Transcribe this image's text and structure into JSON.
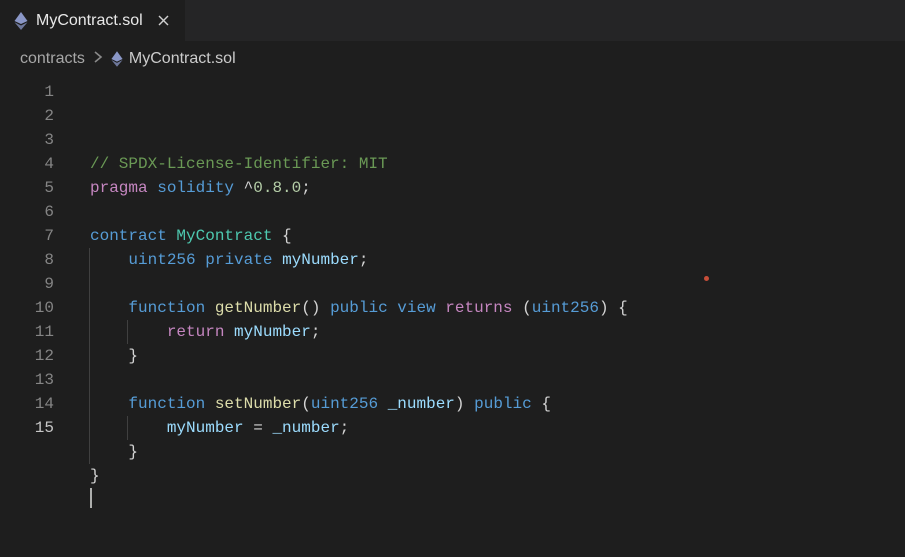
{
  "tab": {
    "filename": "MyContract.sol",
    "language_icon": "ethereum-icon",
    "close_tooltip": "Close"
  },
  "breadcrumb": {
    "segments": [
      {
        "label": "contracts",
        "icon": null
      },
      {
        "label": "MyContract.sol",
        "icon": "ethereum-icon"
      }
    ]
  },
  "editor": {
    "cursor_line": 15,
    "lines": [
      {
        "n": 1,
        "tokens": [
          {
            "t": "// SPDX-License-Identifier: MIT",
            "c": "c-comment"
          }
        ]
      },
      {
        "n": 2,
        "tokens": [
          {
            "t": "pragma",
            "c": "c-keyword"
          },
          {
            "t": " ",
            "c": ""
          },
          {
            "t": "solidity",
            "c": "c-blue"
          },
          {
            "t": " ",
            "c": ""
          },
          {
            "t": "^",
            "c": "c-punc"
          },
          {
            "t": "0.8.0",
            "c": "c-number"
          },
          {
            "t": ";",
            "c": "c-punc"
          }
        ]
      },
      {
        "n": 3,
        "tokens": []
      },
      {
        "n": 4,
        "tokens": [
          {
            "t": "contract",
            "c": "c-blue"
          },
          {
            "t": " ",
            "c": ""
          },
          {
            "t": "MyContract",
            "c": "c-type"
          },
          {
            "t": " ",
            "c": ""
          },
          {
            "t": "{",
            "c": "c-punc"
          }
        ]
      },
      {
        "n": 5,
        "indent": 1,
        "tokens": [
          {
            "t": "uint256",
            "c": "c-blue"
          },
          {
            "t": " ",
            "c": ""
          },
          {
            "t": "private",
            "c": "c-blue"
          },
          {
            "t": " ",
            "c": ""
          },
          {
            "t": "myNumber",
            "c": "c-ident"
          },
          {
            "t": ";",
            "c": "c-punc"
          }
        ]
      },
      {
        "n": 6,
        "indent": 1,
        "tokens": []
      },
      {
        "n": 7,
        "indent": 1,
        "tokens": [
          {
            "t": "function",
            "c": "c-blue"
          },
          {
            "t": " ",
            "c": ""
          },
          {
            "t": "getNumber",
            "c": "c-fn"
          },
          {
            "t": "()",
            "c": "c-punc"
          },
          {
            "t": " ",
            "c": ""
          },
          {
            "t": "public",
            "c": "c-blue"
          },
          {
            "t": " ",
            "c": ""
          },
          {
            "t": "view",
            "c": "c-blue"
          },
          {
            "t": " ",
            "c": ""
          },
          {
            "t": "returns",
            "c": "c-keyword"
          },
          {
            "t": " ",
            "c": ""
          },
          {
            "t": "(",
            "c": "c-punc"
          },
          {
            "t": "uint256",
            "c": "c-blue"
          },
          {
            "t": ")",
            "c": "c-punc"
          },
          {
            "t": " ",
            "c": ""
          },
          {
            "t": "{",
            "c": "c-punc"
          }
        ]
      },
      {
        "n": 8,
        "indent": 2,
        "tokens": [
          {
            "t": "return",
            "c": "c-keyword"
          },
          {
            "t": " ",
            "c": ""
          },
          {
            "t": "myNumber",
            "c": "c-ident"
          },
          {
            "t": ";",
            "c": "c-punc"
          }
        ]
      },
      {
        "n": 9,
        "indent": 1,
        "tokens": [
          {
            "t": "}",
            "c": "c-punc"
          }
        ]
      },
      {
        "n": 10,
        "indent": 1,
        "tokens": []
      },
      {
        "n": 11,
        "indent": 1,
        "tokens": [
          {
            "t": "function",
            "c": "c-blue"
          },
          {
            "t": " ",
            "c": ""
          },
          {
            "t": "setNumber",
            "c": "c-fn"
          },
          {
            "t": "(",
            "c": "c-punc"
          },
          {
            "t": "uint256",
            "c": "c-blue"
          },
          {
            "t": " ",
            "c": ""
          },
          {
            "t": "_number",
            "c": "c-ident"
          },
          {
            "t": ")",
            "c": "c-punc"
          },
          {
            "t": " ",
            "c": ""
          },
          {
            "t": "public",
            "c": "c-blue"
          },
          {
            "t": " ",
            "c": ""
          },
          {
            "t": "{",
            "c": "c-punc"
          }
        ]
      },
      {
        "n": 12,
        "indent": 2,
        "tokens": [
          {
            "t": "myNumber",
            "c": "c-ident"
          },
          {
            "t": " ",
            "c": ""
          },
          {
            "t": "=",
            "c": "c-op"
          },
          {
            "t": " ",
            "c": ""
          },
          {
            "t": "_number",
            "c": "c-ident"
          },
          {
            "t": ";",
            "c": "c-punc"
          }
        ]
      },
      {
        "n": 13,
        "indent": 1,
        "tokens": [
          {
            "t": "}",
            "c": "c-punc"
          }
        ]
      },
      {
        "n": 14,
        "tokens": [
          {
            "t": "}",
            "c": "c-punc"
          }
        ]
      },
      {
        "n": 15,
        "tokens": []
      }
    ]
  },
  "colors": {
    "ethereum_icon": "#8a97c7"
  }
}
